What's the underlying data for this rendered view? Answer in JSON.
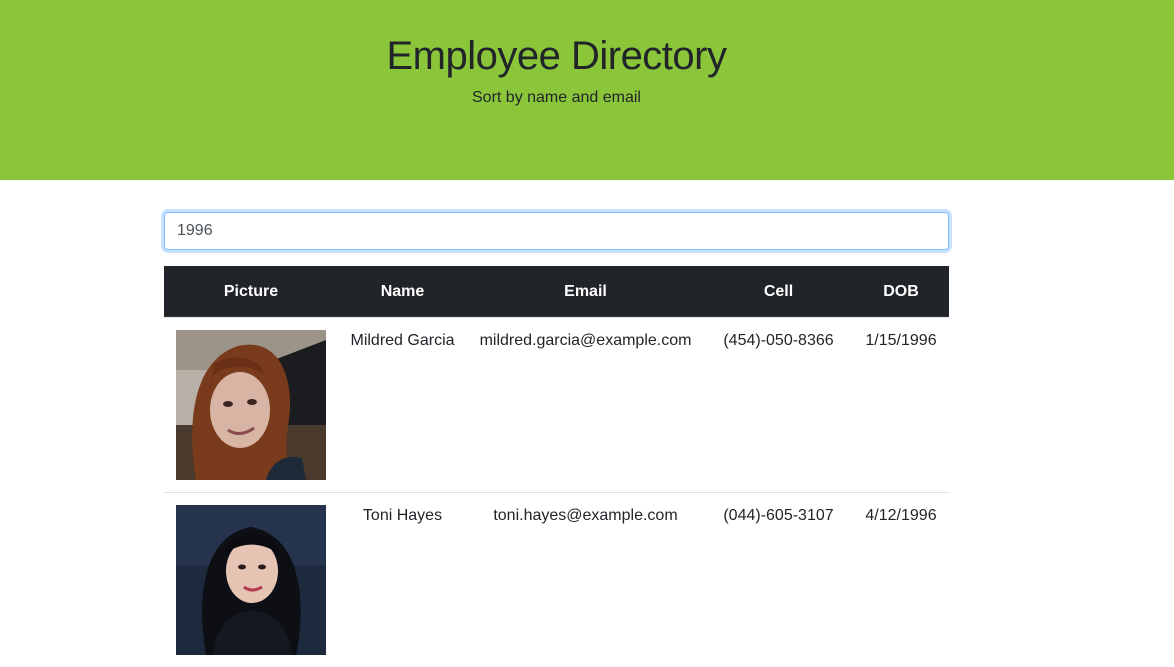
{
  "header": {
    "title": "Employee Directory",
    "subtitle": "Sort by name and email"
  },
  "search": {
    "value": "1996"
  },
  "table": {
    "columns": [
      "Picture",
      "Name",
      "Email",
      "Cell",
      "DOB"
    ],
    "rows": [
      {
        "picture": "portrait-photo",
        "name": "Mildred Garcia",
        "email": "mildred.garcia@example.com",
        "cell": "(454)-050-8366",
        "dob": "1/15/1996"
      },
      {
        "picture": "portrait-photo",
        "name": "Toni Hayes",
        "email": "toni.hayes@example.com",
        "cell": "(044)-605-3107",
        "dob": "4/12/1996"
      }
    ]
  },
  "colors": {
    "hero": "#8bc63a",
    "table_header": "#212529",
    "focus_border": "#80bdff"
  }
}
